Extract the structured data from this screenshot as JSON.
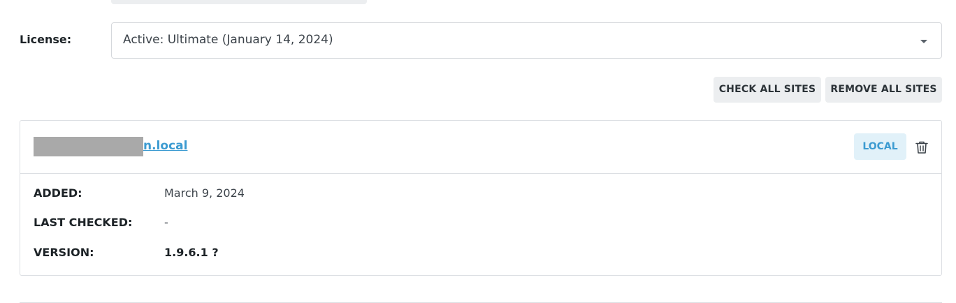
{
  "license": {
    "label": "License:",
    "selected": "Active: Ultimate (January 14, 2024)"
  },
  "actions": {
    "check_all": "CHECK ALL SITES",
    "remove_all": "REMOVE ALL SITES"
  },
  "site": {
    "domain_visible": "n.local",
    "badge": "LOCAL",
    "delete_icon": "trash-icon",
    "details": {
      "added_label": "ADDED:",
      "added_value": "March 9, 2024",
      "checked_label": "LAST CHECKED:",
      "checked_value": "-",
      "version_label": "VERSION:",
      "version_value": "1.9.6.1 ?"
    }
  },
  "colors": {
    "accent": "#3c9bd1",
    "badge_bg": "#e1f1f9",
    "button_bg": "#eceef0",
    "border": "#dcdfe3"
  }
}
